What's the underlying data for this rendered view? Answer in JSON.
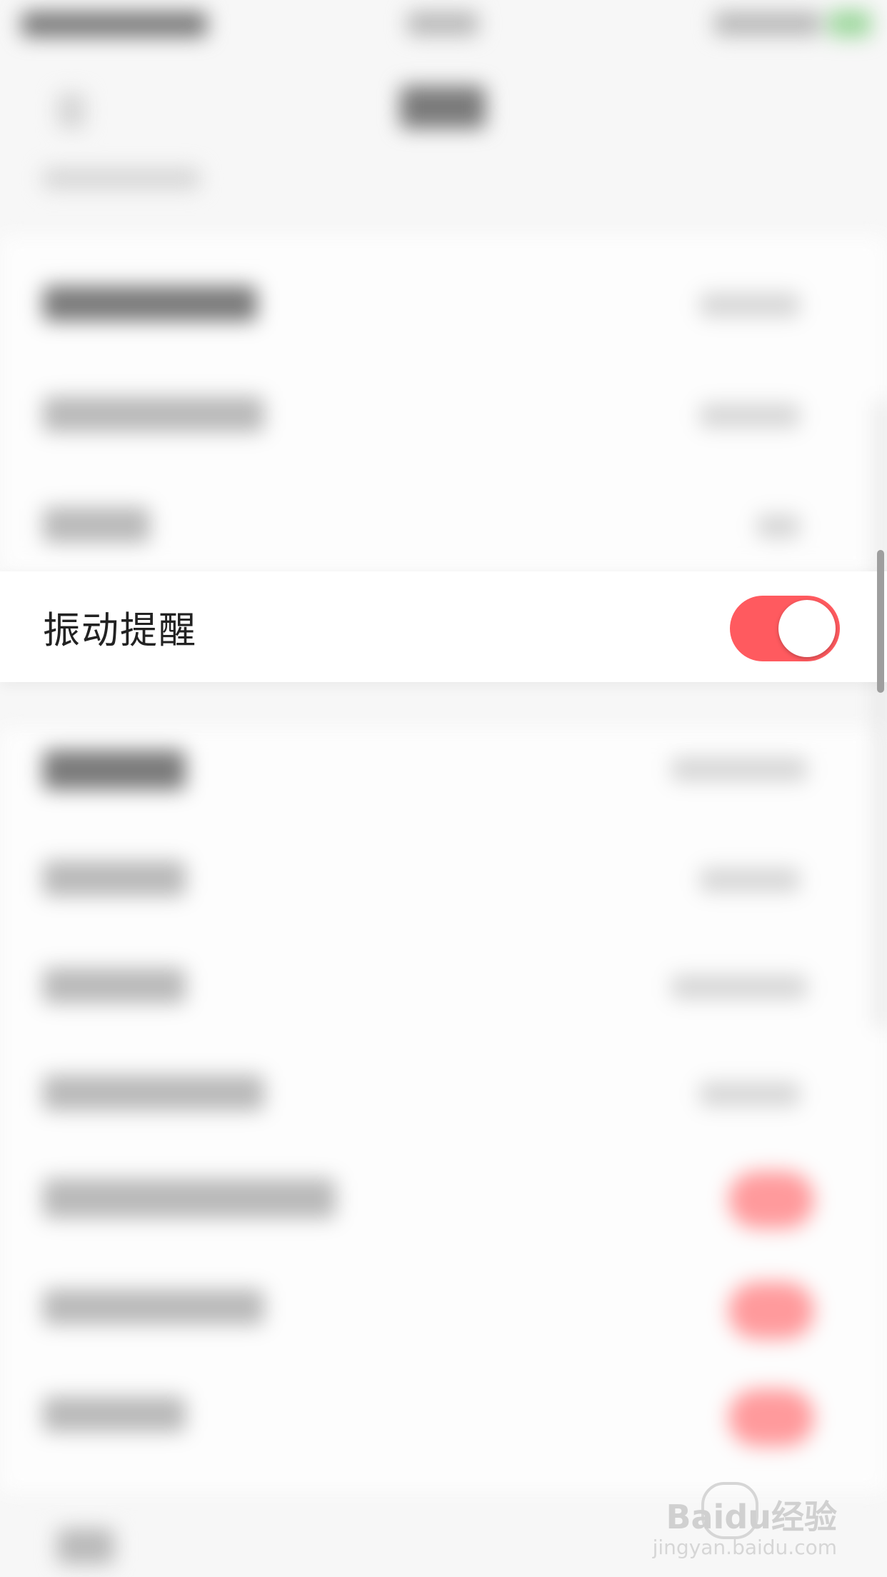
{
  "vibration_setting": {
    "label": "振动提醒",
    "enabled": true,
    "toggle_color": "#ff5a5f"
  },
  "watermark": {
    "brand": "Baidu经验",
    "url": "jingyan.baidu.com"
  }
}
